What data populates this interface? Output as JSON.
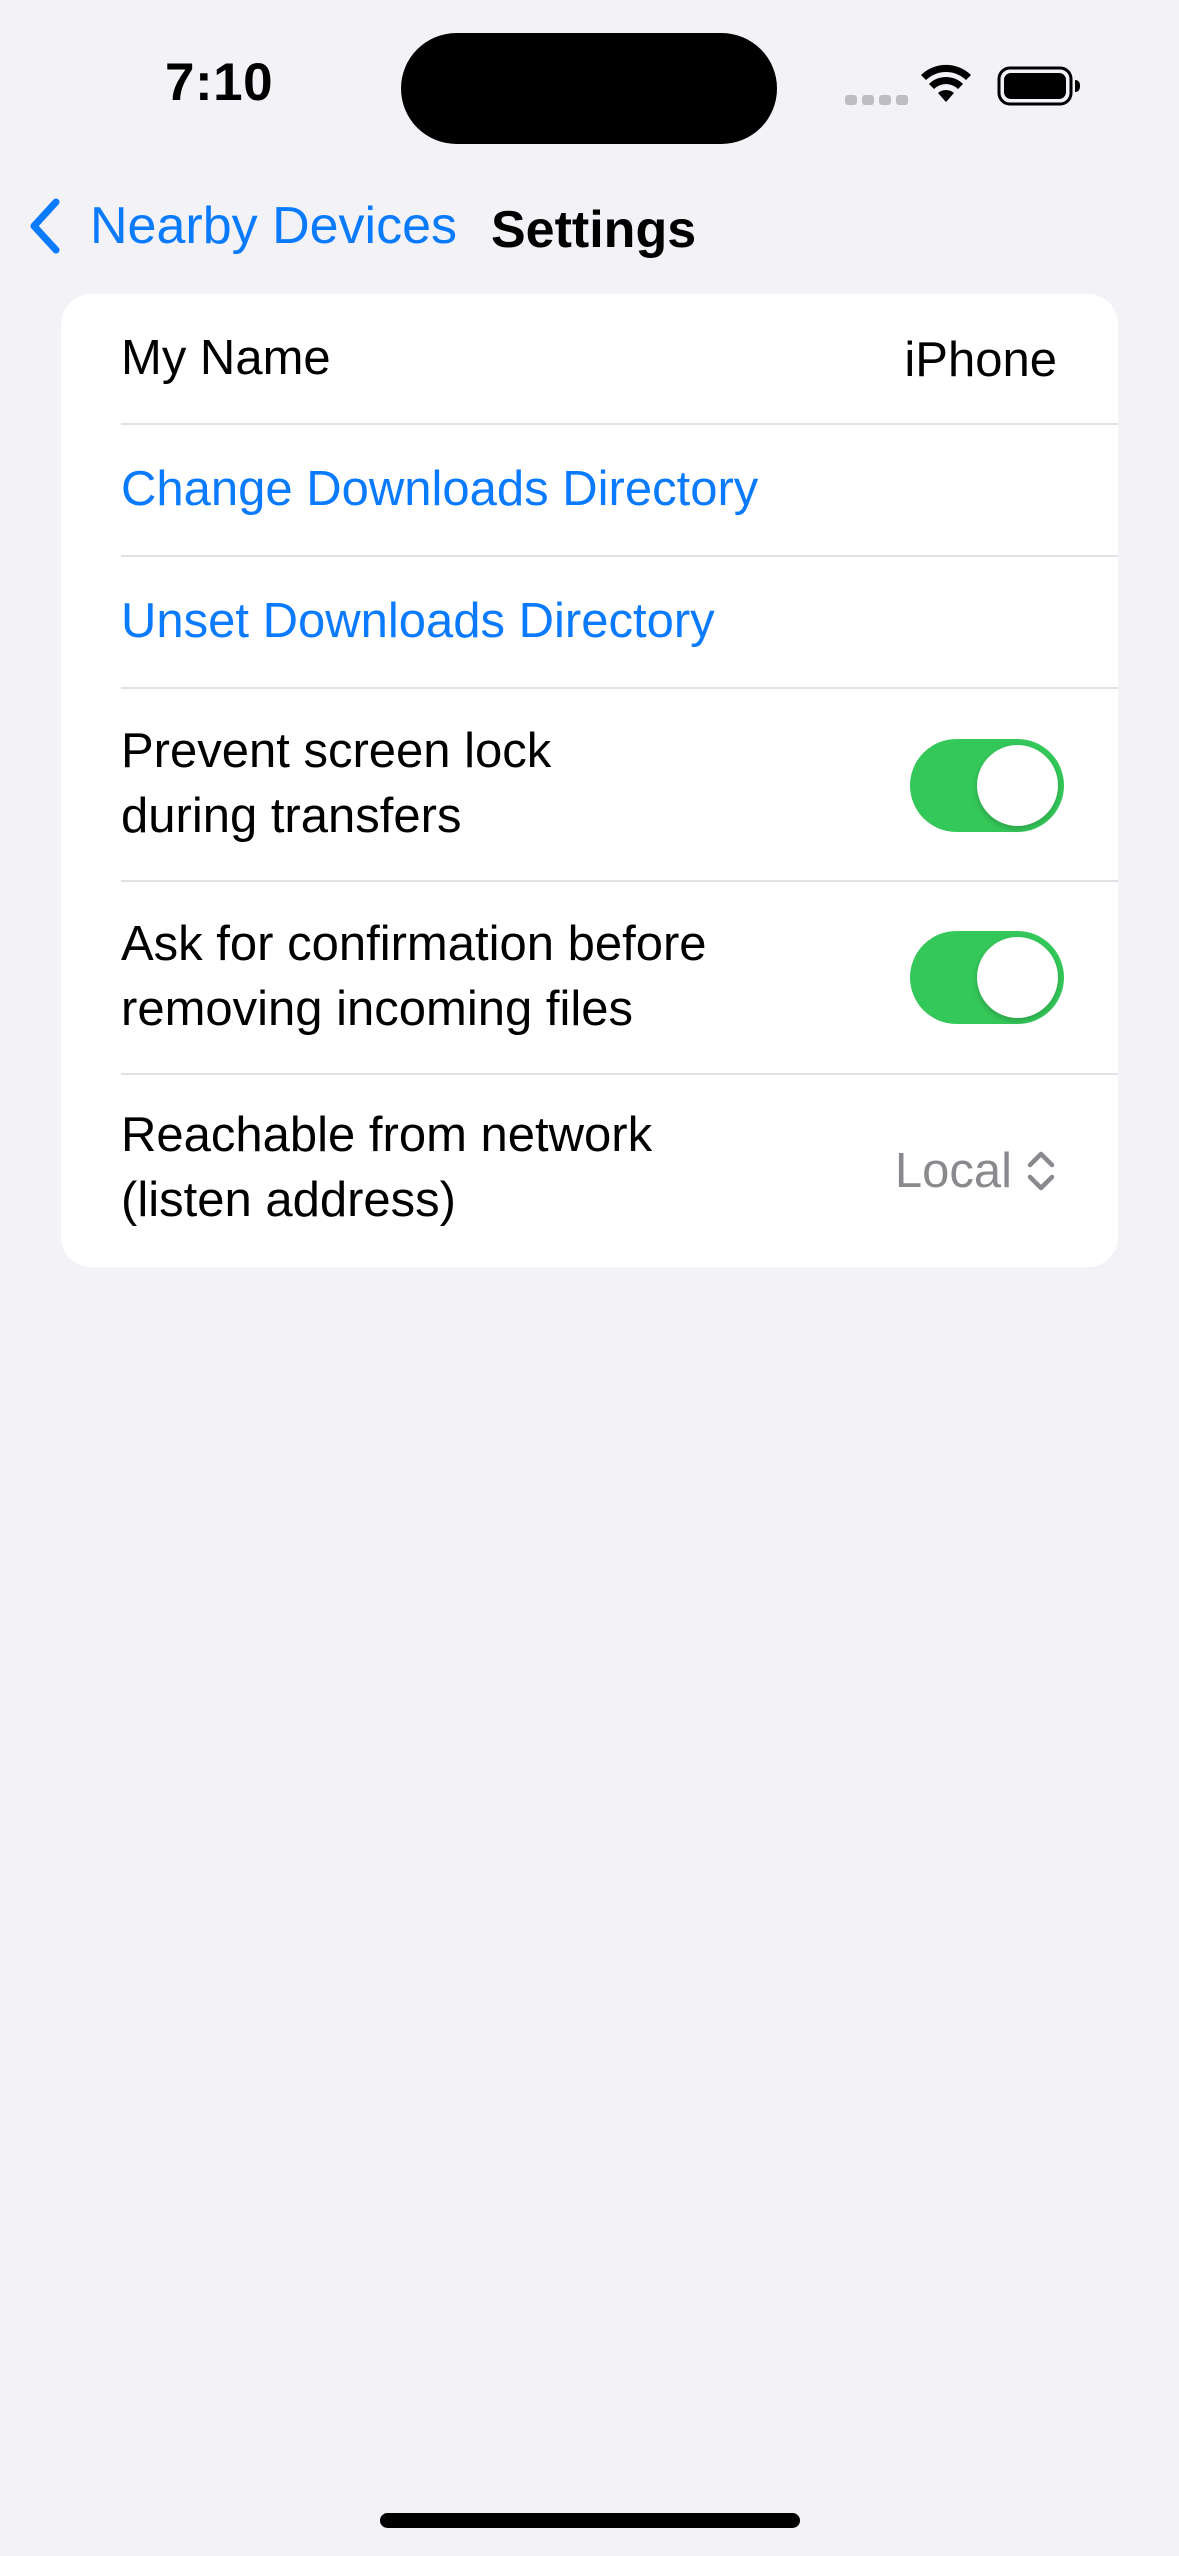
{
  "status_bar": {
    "time": "7:10"
  },
  "nav": {
    "back_label": "Nearby Devices",
    "title": "Settings"
  },
  "settings": {
    "my_name_label": "My Name",
    "my_name_value": "iPhone",
    "change_dir_label": "Change Downloads Directory",
    "unset_dir_label": "Unset Downloads Directory",
    "prevent_lock_line1": "Prevent screen lock",
    "prevent_lock_line2": "during transfers",
    "prevent_lock_on": true,
    "confirm_remove_line1": "Ask for confirmation before",
    "confirm_remove_line2": "removing incoming files",
    "confirm_remove_on": true,
    "reachable_line1": "Reachable from network",
    "reachable_line2": "(listen address)",
    "reachable_value": "Local"
  },
  "colors": {
    "accent": "#0A7AFF",
    "toggle_on": "#34C759",
    "background": "#F2F2F7"
  },
  "icons": [
    "chevron-left-icon",
    "wifi-icon",
    "battery-icon",
    "chevron-up-down-icon"
  ]
}
